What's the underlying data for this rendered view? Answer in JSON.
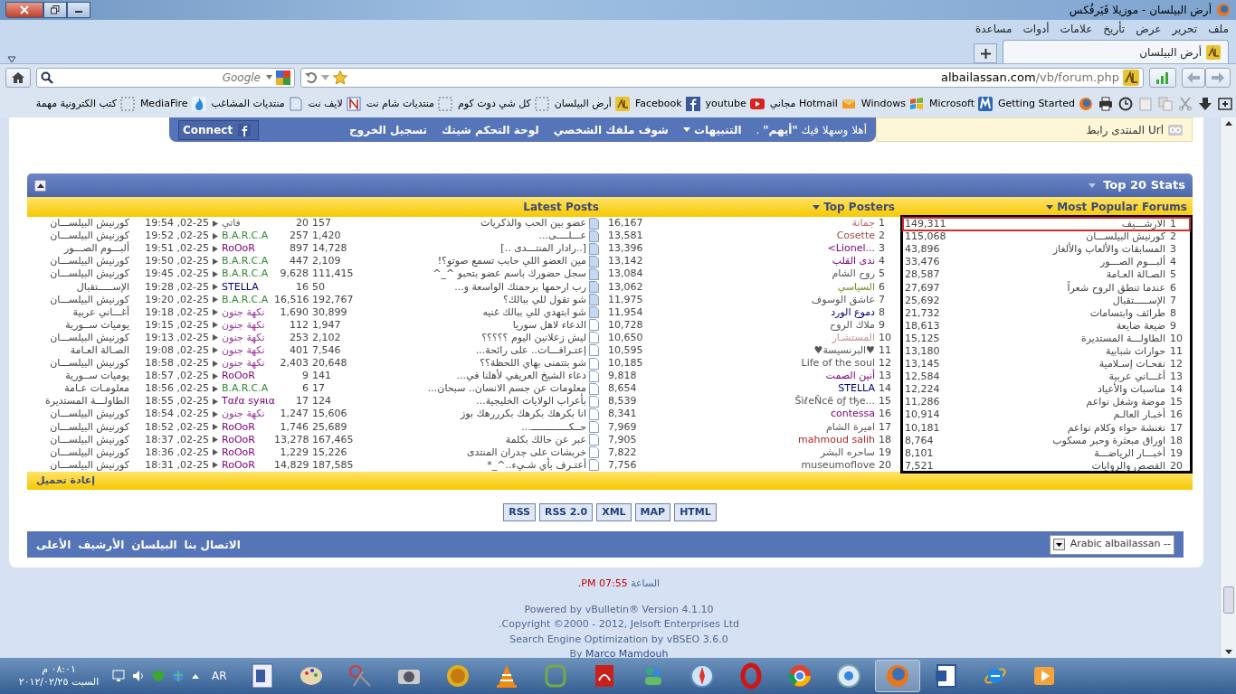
{
  "window": {
    "title": "أرض البيلسان - موزيلا فَيَرفُكس"
  },
  "menu": [
    "ملف",
    "تحرير",
    "عرض",
    "تأريخ",
    "علامات",
    "أدوات",
    "مساعدة"
  ],
  "tabs": [
    {
      "label": "أرض البيلسان",
      "selected": true
    }
  ],
  "address_bar": {
    "host": "albailassan.com",
    "path": "/vb/forum.php"
  },
  "search": {
    "placeholder": "Google"
  },
  "bookmarks": [
    {
      "label": "Getting Started"
    },
    {
      "label": "Microsoft"
    },
    {
      "label": "Windows"
    },
    {
      "label": "Hotmail مجاني"
    },
    {
      "label": "youtube"
    },
    {
      "label": "Facebook"
    },
    {
      "label": "أرض البيلسان"
    },
    {
      "label": "كل شي دوت كوم"
    },
    {
      "label": "منتديات شام نت"
    },
    {
      "label": "لايف نت"
    },
    {
      "label": "منتديات المشاغب"
    },
    {
      "label": "MediaFire"
    },
    {
      "label": "كتب الكترونية مهمة"
    }
  ],
  "user_bar": {
    "shortcut": "المنتدى رابط Url",
    "greeting": "أهلا وسهلا فيك **\"أيهم\"** .",
    "links": [
      {
        "label": "التنبيهات",
        "has_menu": true
      },
      {
        "label": "شوف ملفك الشخصي",
        "has_menu": false
      },
      {
        "label": "لوحة التحكم شيتك",
        "has_menu": false
      },
      {
        "label": "تسجيل الخروج",
        "has_menu": false
      }
    ],
    "connect_button": "Connect"
  },
  "stats": {
    "title": "Top 20 Stats",
    "reload": "إعادة تحميل",
    "popular_forums": {
      "heading": "Most Popular Forums",
      "rows": [
        {
          "rank": "1",
          "name": "الارشـــيف",
          "count": "149,311",
          "highlighted": true
        },
        {
          "rank": "2",
          "name": "كورنيش البيلســـان",
          "count": "115,068",
          "highlighted": false
        },
        {
          "rank": "3",
          "name": "المسابقات والألعاب والألغاز",
          "count": "43,896",
          "highlighted": false
        },
        {
          "rank": "4",
          "name": "ألبـــوم الصـــور",
          "count": "33,476",
          "highlighted": false
        },
        {
          "rank": "5",
          "name": "الصـالة العـامة",
          "count": "28,587",
          "highlighted": false
        },
        {
          "rank": "6",
          "name": "عندما تنطق الروح شعراً",
          "count": "27,697",
          "highlighted": false
        },
        {
          "rank": "7",
          "name": "الإســـــتقبال",
          "count": "25,692",
          "highlighted": false
        },
        {
          "rank": "8",
          "name": "طرائف وابتسامات",
          "count": "21,732",
          "highlighted": false
        },
        {
          "rank": "9",
          "name": "ضيعة ضايعة",
          "count": "18,613",
          "highlighted": false
        },
        {
          "rank": "10",
          "name": "الطاولـــة المستديرة",
          "count": "15,125",
          "highlighted": false
        },
        {
          "rank": "11",
          "name": "حوارات شبابية",
          "count": "13,180",
          "highlighted": false
        },
        {
          "rank": "12",
          "name": "نفحـات إسـلامية",
          "count": "13,145",
          "highlighted": false
        },
        {
          "rank": "13",
          "name": "أغـــاني عربية",
          "count": "12,584",
          "highlighted": false
        },
        {
          "rank": "14",
          "name": "مناسبات والأعياد",
          "count": "12,224",
          "highlighted": false
        },
        {
          "rank": "15",
          "name": "موضة وشغل نواعم",
          "count": "11,286",
          "highlighted": false
        },
        {
          "rank": "16",
          "name": "أخبـار العالـم",
          "count": "10,914",
          "highlighted": false
        },
        {
          "rank": "17",
          "name": "نغنشة حواء وكلام نواعم",
          "count": "10,181",
          "highlighted": false
        },
        {
          "rank": "18",
          "name": "اوراق مبعثرة وحبر مسكوب",
          "count": "8,764",
          "highlighted": false
        },
        {
          "rank": "19",
          "name": "أخبـــار الرياضـــة",
          "count": "8,101",
          "highlighted": false
        },
        {
          "rank": "20",
          "name": "القصص والروايات",
          "count": "7,521",
          "highlighted": false
        }
      ]
    },
    "top_posters": {
      "heading": "Top Posters",
      "rows": [
        {
          "rank": "1",
          "name": "جمانة",
          "color": "#c06a6a",
          "posts": "16,167"
        },
        {
          "rank": "2",
          "name": "Cosette",
          "color": "#a04848",
          "posts": "13,581"
        },
        {
          "rank": "3",
          "name": "<Lionel...",
          "color": "#800080",
          "posts": "13,396"
        },
        {
          "rank": "4",
          "name": "ندى القلب",
          "color": "#800080",
          "posts": "13,142"
        },
        {
          "rank": "5",
          "name": "روح الشام",
          "color": "#555555",
          "posts": "13,084"
        },
        {
          "rank": "6",
          "name": "السياسي",
          "color": "#6b8e23",
          "posts": "13,062"
        },
        {
          "rank": "7",
          "name": "عاشق الوسوف",
          "color": "#555555",
          "posts": "11,975"
        },
        {
          "rank": "8",
          "name": "دموع الورد",
          "color": "#000080",
          "posts": "11,954"
        },
        {
          "rank": "9",
          "name": "ملاك الروح",
          "color": "#555555",
          "posts": "10,728"
        },
        {
          "rank": "10",
          "name": "المستشـار",
          "color": "#c99090",
          "posts": "10,650"
        },
        {
          "rank": "11",
          "name": "♥البرنسيسة♥",
          "color": "#555555",
          "posts": "10,595"
        },
        {
          "rank": "12",
          "name": "Life of the soul",
          "color": "#555555",
          "posts": "10,185"
        },
        {
          "rank": "13",
          "name": "أنين الصمت",
          "color": "#800080",
          "posts": "9,818"
        },
        {
          "rank": "14",
          "name": "STELLA",
          "color": "#000080",
          "posts": "8,654"
        },
        {
          "rank": "15",
          "name": "ŠìℓeŇcё oƒ tђe...",
          "color": "#555555",
          "posts": "8,539"
        },
        {
          "rank": "16",
          "name": "contessa",
          "color": "#800080",
          "posts": "8,341"
        },
        {
          "rank": "17",
          "name": "اميرة الشام",
          "color": "#555555",
          "posts": "7,969"
        },
        {
          "rank": "18",
          "name": "mahmoud salih",
          "color": "#b22222",
          "posts": "7,905"
        },
        {
          "rank": "19",
          "name": "ساحره البشر",
          "color": "#555555",
          "posts": "7,822"
        },
        {
          "rank": "20",
          "name": "museumoflove",
          "color": "#555555",
          "posts": "7,756"
        }
      ]
    },
    "latest_posts": {
      "heading": "Latest Posts",
      "rows": [
        {
          "title": "عضو بين الحب والذكريات",
          "unread": true,
          "count_a": "157",
          "count_b": "20",
          "poster": "فاتي",
          "color": "#666666",
          "date": "02-25, 19:54",
          "forum": "كورنيش البيلســـان"
        },
        {
          "title": "عـــلــــى...",
          "unread": true,
          "count_a": "1,420",
          "count_b": "257",
          "poster": "B.A.R.C.A",
          "color": "#2e8b2e",
          "date": "02-25, 19:52",
          "forum": "كورنيش البيلســـان"
        },
        {
          "title": "[..رادار المنتـــدى ..]",
          "unread": true,
          "count_a": "14,728",
          "count_b": "897",
          "poster": "RoOoR",
          "color": "#800080",
          "date": "02-25, 19:51",
          "forum": "ألبـــوم الصـــور"
        },
        {
          "title": "مين العضو اللي حابب تسمع صوتو؟!",
          "unread": true,
          "count_a": "2,109",
          "count_b": "447",
          "poster": "B.A.R.C.A",
          "color": "#2e8b2e",
          "date": "02-25, 19:50",
          "forum": "كورنيش البيلســـان"
        },
        {
          "title": "سجل حضورك باسم عضو بتحبو ^_^",
          "unread": true,
          "count_a": "111,415",
          "count_b": "9,628",
          "poster": "B.A.R.C.A",
          "color": "#2e8b2e",
          "date": "02-25, 19:45",
          "forum": "كورنيش البيلســـان"
        },
        {
          "title": "رب ارحمها برحمتك الواسعة و...",
          "unread": true,
          "count_a": "50",
          "count_b": "16",
          "poster": "STELLA",
          "color": "#000080",
          "date": "02-25, 19:28",
          "forum": "الإســـــتقبال"
        },
        {
          "title": "شو تقول للي ببالك؟",
          "unread": true,
          "count_a": "192,767",
          "count_b": "16,516",
          "poster": "B.A.R.C.A",
          "color": "#2e8b2e",
          "date": "02-25, 19:20",
          "forum": "كورنيش البيلســـان"
        },
        {
          "title": "شو ابتهدي للي ببالك غنيه",
          "unread": true,
          "count_a": "30,899",
          "count_b": "1,690",
          "poster": "نكهة جنون",
          "color": "#993399",
          "date": "02-25, 19:18",
          "forum": "أغـــاني عربية"
        },
        {
          "title": "الدعاء لاهل سوريا",
          "unread": false,
          "count_a": "1,947",
          "count_b": "112",
          "poster": "نكهة جنون",
          "color": "#993399",
          "date": "02-25, 19:15",
          "forum": "يوميات ســورية"
        },
        {
          "title": "ليش زعلانين اليوم ؟؟؟؟؟",
          "unread": false,
          "count_a": "2,102",
          "count_b": "253",
          "poster": "نكهة جنون",
          "color": "#993399",
          "date": "02-25, 19:13",
          "forum": "كورنيش البيلســـان"
        },
        {
          "title": "إعتـرافـــات.. على رائحة...",
          "unread": false,
          "count_a": "7,546",
          "count_b": "401",
          "poster": "نكهة جنون",
          "color": "#993399",
          "date": "02-25, 19:08",
          "forum": "الصـالة العـامة"
        },
        {
          "title": "شو بتتمنى بهاي اللحظة؟؟",
          "unread": false,
          "count_a": "20,648",
          "count_b": "2,403",
          "poster": "نكهة جنون",
          "color": "#993399",
          "date": "02-25, 18:58",
          "forum": "كورنيش البيلســـان"
        },
        {
          "title": "دعاء الشيخ العريفي لأهلنا في...",
          "unread": false,
          "count_a": "141",
          "count_b": "9",
          "poster": "RoOoR",
          "color": "#800080",
          "date": "02-25, 18:57",
          "forum": "يوميات ســورية"
        },
        {
          "title": "معلومات عن جسم الانسان.. سبحان...",
          "unread": false,
          "count_a": "17",
          "count_b": "6",
          "poster": "B.A.R.C.A",
          "color": "#2e8b2e",
          "date": "02-25, 18:56",
          "forum": "معلومـات عـامة"
        },
        {
          "title": "بأعراب الولايات الخليجية...",
          "unread": false,
          "count_a": "124",
          "count_b": "17",
          "poster": "Tαℓα ѕуяια",
          "color": "#800080",
          "date": "02-25, 18:55",
          "forum": "الطاولـــة المستديرة"
        },
        {
          "title": "انا بكرهك بكرهك بكرررهك بوز",
          "unread": false,
          "count_a": "15,606",
          "count_b": "1,247",
          "poster": "نكهة جنون",
          "color": "#993399",
          "date": "02-25, 18:54",
          "forum": "كورنيش البيلســـان"
        },
        {
          "title": "حــكـــــــــــــ...",
          "unread": false,
          "count_a": "25,689",
          "count_b": "1,746",
          "poster": "RoOoR",
          "color": "#800080",
          "date": "02-25, 18:52",
          "forum": "كورنيش البيلســـان"
        },
        {
          "title": "عبر عن حالك بكلمة",
          "unread": false,
          "count_a": "167,465",
          "count_b": "13,278",
          "poster": "RoOoR",
          "color": "#800080",
          "date": "02-25, 18:37",
          "forum": "كورنيش البيلســـان"
        },
        {
          "title": "خربشات على جدران المنتدى",
          "unread": false,
          "count_a": "15,226",
          "count_b": "1,229",
          "poster": "RoOoR",
          "color": "#800080",
          "date": "02-25, 18:36",
          "forum": "كورنيش البيلســـان"
        },
        {
          "title": "أعتـرف بأي شـيء..^_*",
          "unread": false,
          "count_a": "187,585",
          "count_b": "14,829",
          "poster": "RoOoR",
          "color": "#800080",
          "date": "02-25, 18:31",
          "forum": "كورنيش البيلســـان"
        }
      ]
    }
  },
  "feed_buttons": [
    "HTML",
    "MAP",
    "XML",
    "RSS 2.0",
    "RSS"
  ],
  "footer_nav": {
    "links": [
      "الاتصال بنا",
      "البيلسان",
      "الأرشيف",
      "الأعلى"
    ],
    "style_select": "Arabic albailassan --"
  },
  "server_time": {
    "label": "الساعة",
    "value": "07:55 PM."
  },
  "credits": [
    "Powered by vBulletin® Version 4.1.10",
    "Copyright ©2000 - 2012, Jelsoft Enterprises Ltd.",
    "Search Engine Optimization by vBSEO 3.6.0"
  ],
  "author": {
    "prefix": "By",
    "name": "Marco Mamdouh"
  },
  "taskbar": {
    "language": "AR",
    "time": "٠٨:٠١ م",
    "date": "السبت ٢٠١٢/٠٢/٢٥"
  }
}
